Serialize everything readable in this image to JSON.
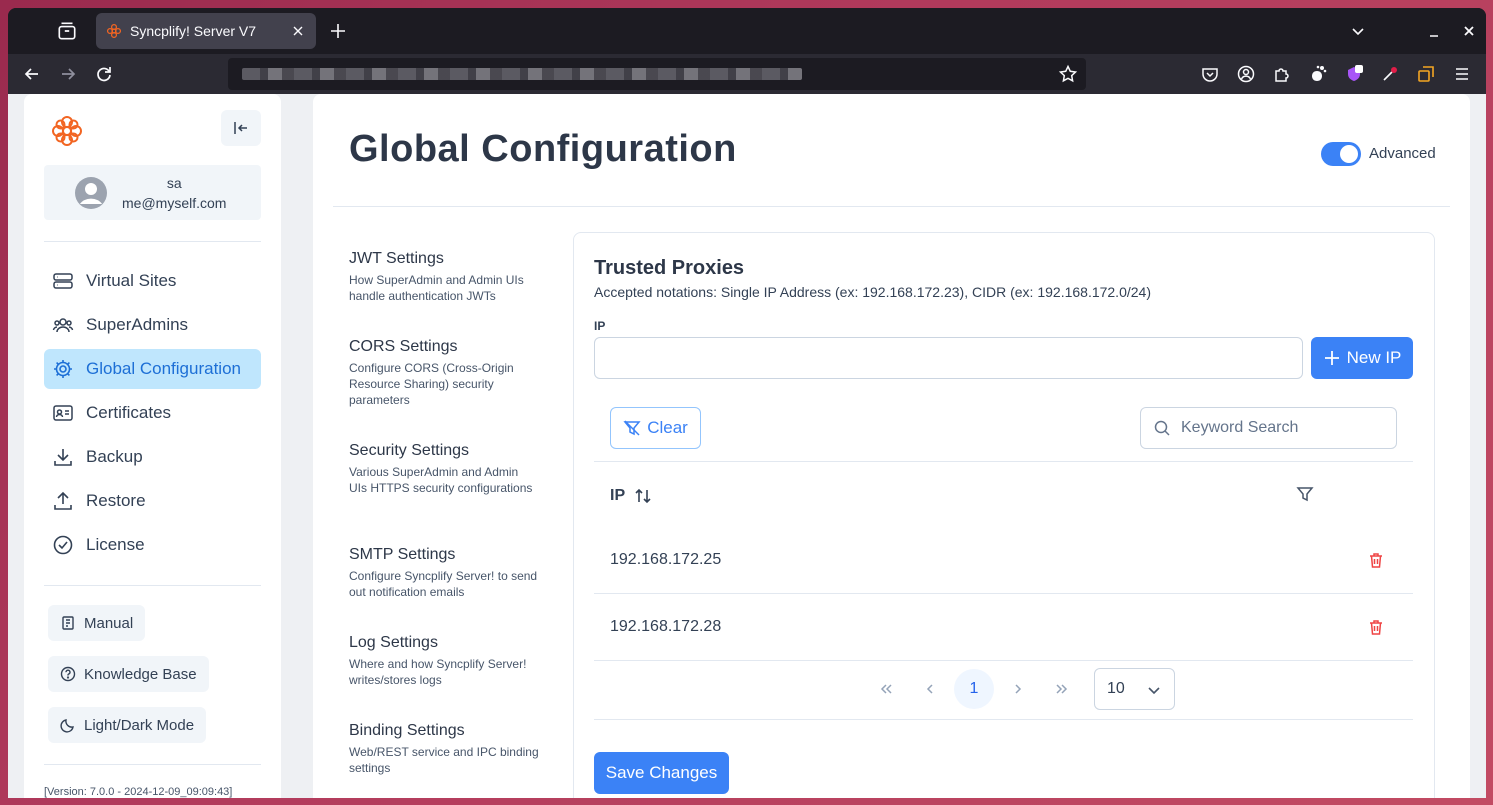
{
  "browser": {
    "tab_title": "Syncplify! Server V7"
  },
  "sidebar": {
    "user_name": "sa",
    "user_email": "me@myself.com",
    "menu": [
      {
        "label": "Virtual Sites",
        "icon": "server-icon"
      },
      {
        "label": "SuperAdmins",
        "icon": "users-icon"
      },
      {
        "label": "Global Configuration",
        "icon": "gear-icon",
        "active": true
      },
      {
        "label": "Certificates",
        "icon": "id-card-icon"
      },
      {
        "label": "Backup",
        "icon": "download-icon"
      },
      {
        "label": "Restore",
        "icon": "upload-icon"
      },
      {
        "label": "License",
        "icon": "check-circle-icon"
      }
    ],
    "buttons": {
      "manual": "Manual",
      "knowledge_base": "Knowledge Base",
      "light_dark": "Light/Dark Mode"
    },
    "version": "[Version: 7.0.0 - 2024-12-09_09:09:43]"
  },
  "main": {
    "title": "Global Configuration",
    "advanced_label": "Advanced",
    "advanced_on": true
  },
  "settings_nav": [
    {
      "title": "JWT Settings",
      "desc": "How SuperAdmin and Admin UIs handle authentication JWTs"
    },
    {
      "title": "CORS Settings",
      "desc": "Configure CORS (Cross-Origin Resource Sharing) security parameters"
    },
    {
      "title": "Security Settings",
      "desc": "Various SuperAdmin and Admin UIs HTTPS security configurations"
    },
    {
      "title": "SMTP Settings",
      "desc": "Configure Syncplify Server! to send out notification emails"
    },
    {
      "title": "Log Settings",
      "desc": "Where and how Syncplify Server! writes/stores logs"
    },
    {
      "title": "Binding Settings",
      "desc": "Web/REST service and IPC binding settings"
    }
  ],
  "proxies": {
    "title": "Trusted Proxies",
    "subtitle": "Accepted notations: Single IP Address (ex: 192.168.172.23), CIDR (ex: 192.168.172.0/24)",
    "ip_label": "IP",
    "ip_value": "",
    "new_ip_label": "New IP",
    "clear_label": "Clear",
    "search_placeholder": "Keyword Search",
    "column_ip": "IP",
    "rows": [
      "192.168.172.25",
      "192.168.172.28"
    ],
    "current_page": "1",
    "page_size": "10",
    "save_label": "Save Changes"
  },
  "colors": {
    "accent": "#3b82f6",
    "active_menu_bg": "#bfe6fd",
    "danger": "#ef4444",
    "logo": "#f26522"
  }
}
